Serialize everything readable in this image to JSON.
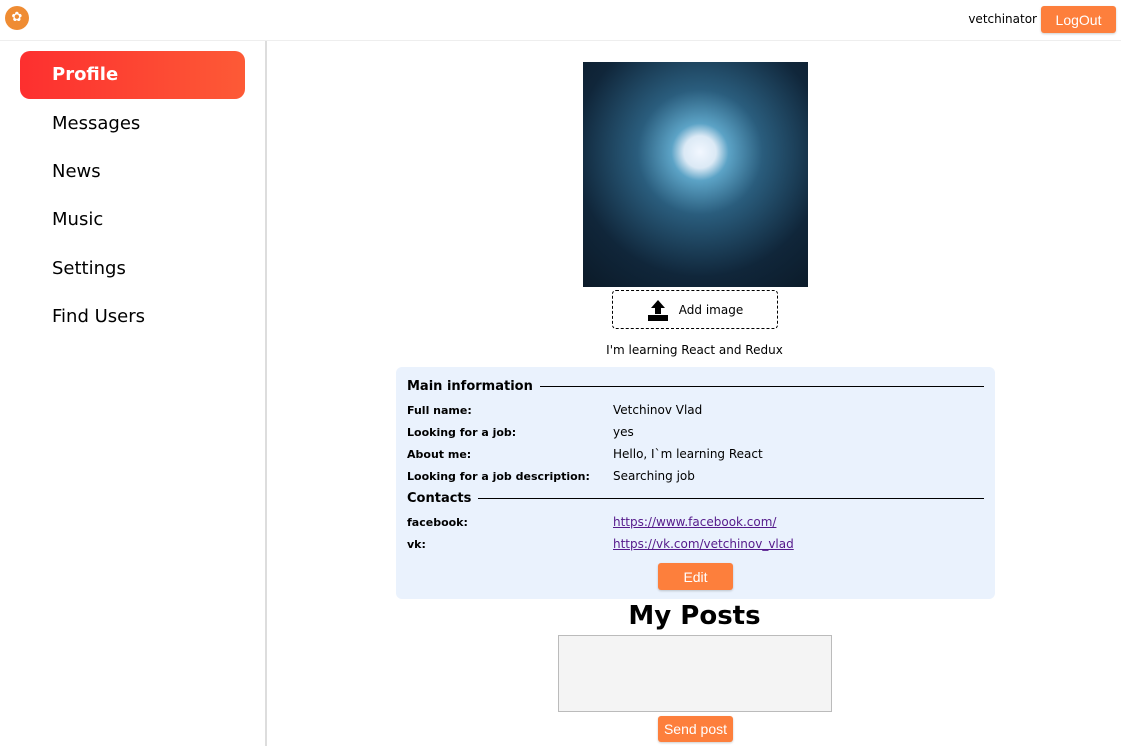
{
  "header": {
    "logo_glyph": "✿",
    "username": "vetchinator",
    "logout": "LogOut"
  },
  "sidebar": {
    "items": [
      {
        "label": "Profile",
        "active": true
      },
      {
        "label": "Messages"
      },
      {
        "label": "News"
      },
      {
        "label": "Music"
      },
      {
        "label": "Settings"
      },
      {
        "label": "Find Users"
      }
    ]
  },
  "profile": {
    "add_image": "Add image",
    "status": "I'm learning React and Redux",
    "main_title": "Main information",
    "fields": [
      {
        "k": "Full name:",
        "v": "Vetchinov Vlad"
      },
      {
        "k": "Looking for a job:",
        "v": "yes"
      },
      {
        "k": "About me:",
        "v": "Hello, I`m learning React"
      },
      {
        "k": "Looking for a job description:",
        "v": "Searching job"
      }
    ],
    "contacts_title": "Contacts",
    "contacts": [
      {
        "k": "facebook:",
        "v": "https://www.facebook.com/"
      },
      {
        "k": "vk:",
        "v": "https://vk.com/vetchinov_vlad"
      }
    ],
    "edit": "Edit"
  },
  "posts": {
    "title": "My Posts",
    "textarea_value": "",
    "send": "Send post"
  }
}
